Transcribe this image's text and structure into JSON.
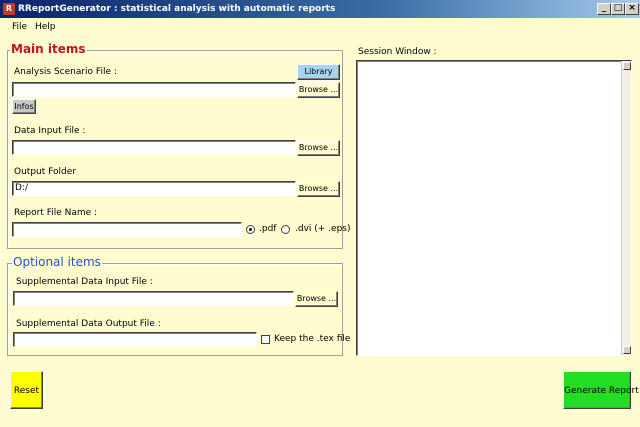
{
  "window": {
    "title": "RReportGenerator : statistical analysis with automatic reports",
    "icon_label": "R",
    "controls": {
      "minimize": "_",
      "maximize": "□",
      "close": "×"
    }
  },
  "menu": {
    "file": "File",
    "help": "Help"
  },
  "main_items": {
    "legend": "Main items",
    "scenario_label": "Analysis Scenario File :",
    "scenario_value": "",
    "library_label": "Library",
    "browse_label": "Browse ...",
    "infos_label": "Infos",
    "data_input_label": "Data Input File :",
    "data_input_value": "",
    "output_folder_label": "Output Folder",
    "output_folder_value": "D:/",
    "report_name_label": "Report File Name :",
    "report_name_value": "",
    "format_pdf_label": ".pdf",
    "format_dvi_label": ".dvi (+ .eps)",
    "selected_format": "pdf"
  },
  "optional_items": {
    "legend": "Optional items",
    "supp_input_label": "Supplemental Data Input File :",
    "supp_input_value": "",
    "supp_output_label": "Supplemental Data Output File :",
    "supp_output_value": "",
    "keep_tex_label": "Keep the .tex file",
    "keep_tex_checked": false
  },
  "session": {
    "label": "Session Window :"
  },
  "actions": {
    "reset_label": "Reset",
    "generate_label": "Generate Report"
  },
  "colors": {
    "background": "#fffdd0",
    "main_legend": "#c0102a",
    "optional_legend": "#2a4fd0",
    "library_button": "#a9d4f0",
    "reset_button": "#ffff00",
    "generate_button": "#22dd22"
  }
}
